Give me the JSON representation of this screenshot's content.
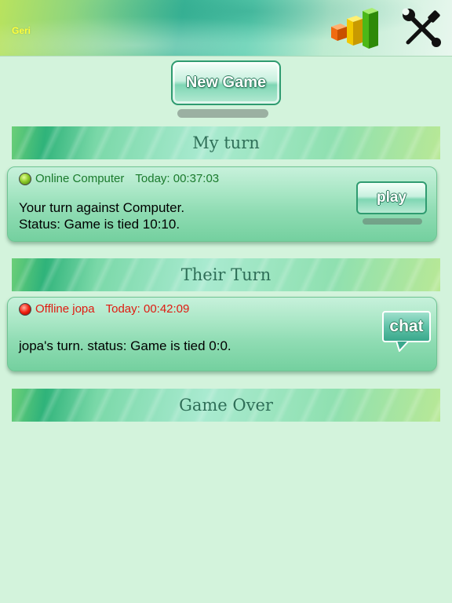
{
  "header": {
    "user_name": "Geri",
    "stats_icon": "bar-chart-icon",
    "settings_icon": "tools-icon"
  },
  "new_game": {
    "label": "New Game"
  },
  "sections": {
    "my_turn": "My turn",
    "their_turn": "Their Turn",
    "game_over": "Game Over"
  },
  "games": [
    {
      "status": "online",
      "status_color": "#1a7a2c",
      "head_label": "Online Computer",
      "time": "Today: 00:37:03",
      "line1": "Your turn against Computer.",
      "line2": "Status: Game is tied 10:10.",
      "action_label": "play"
    },
    {
      "status": "offline",
      "status_color": "#e01a10",
      "head_label": "Offline jopa",
      "time": "Today: 00:42:09",
      "line1": "jopa's turn. status: Game is tied 0:0.",
      "action_label": "chat"
    }
  ],
  "colors": {
    "background": "#d3f3dc",
    "accent": "#2f9b70",
    "user_name": "#ffff3a"
  }
}
